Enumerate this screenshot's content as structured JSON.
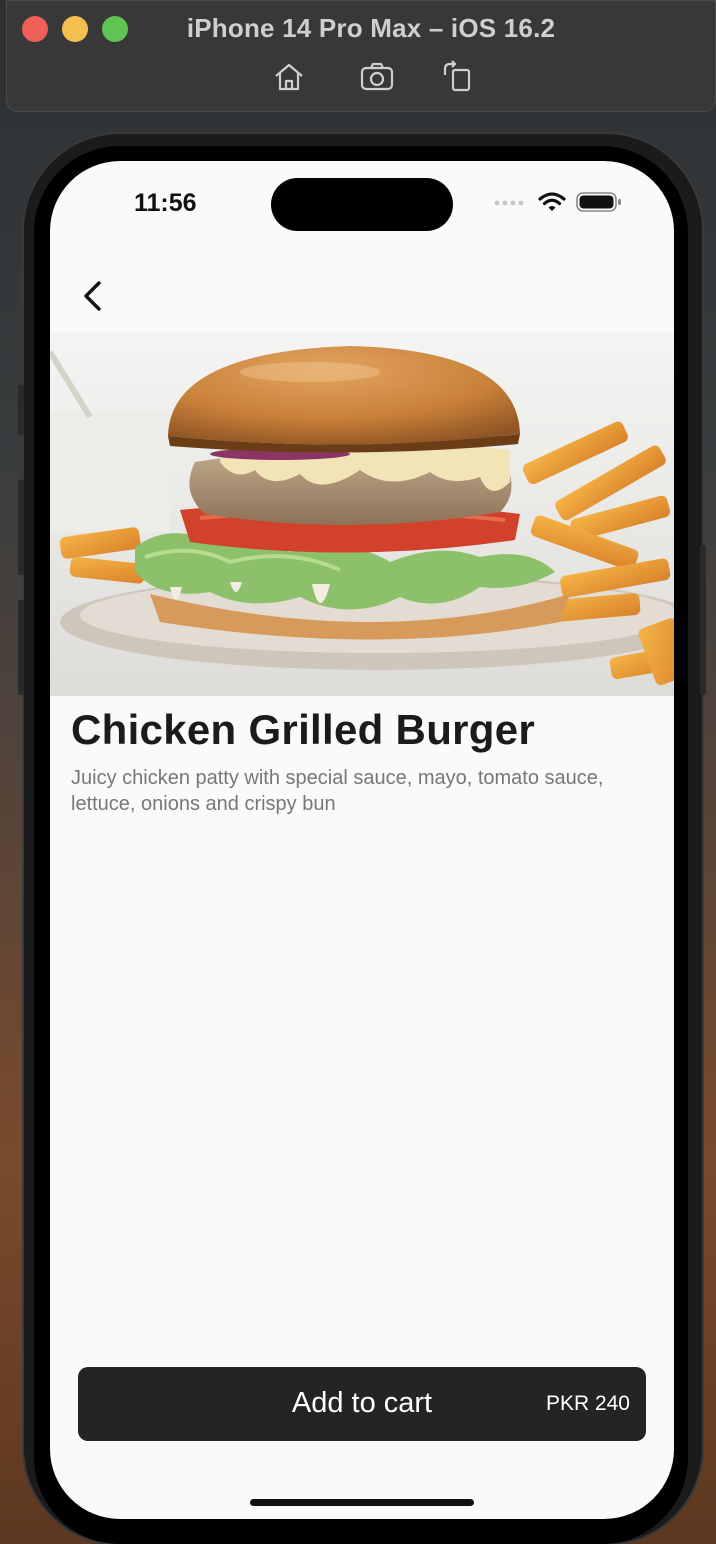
{
  "simulator": {
    "title": "iPhone 14 Pro Max – iOS 16.2",
    "toolbar": [
      "home-icon",
      "screenshot-icon",
      "rotate-icon"
    ]
  },
  "status_bar": {
    "time": "11:56"
  },
  "product": {
    "name": "Chicken Grilled Burger",
    "description": "Juicy chicken patty with special sauce, mayo, tomato sauce, lettuce, onions and crispy bun"
  },
  "cart_button": {
    "label": "Add to cart",
    "price": "PKR 240"
  },
  "colors": {
    "button_bg": "#242424",
    "screen_bg": "#fafafa",
    "title": "#1b1b1b",
    "description": "#777777"
  }
}
